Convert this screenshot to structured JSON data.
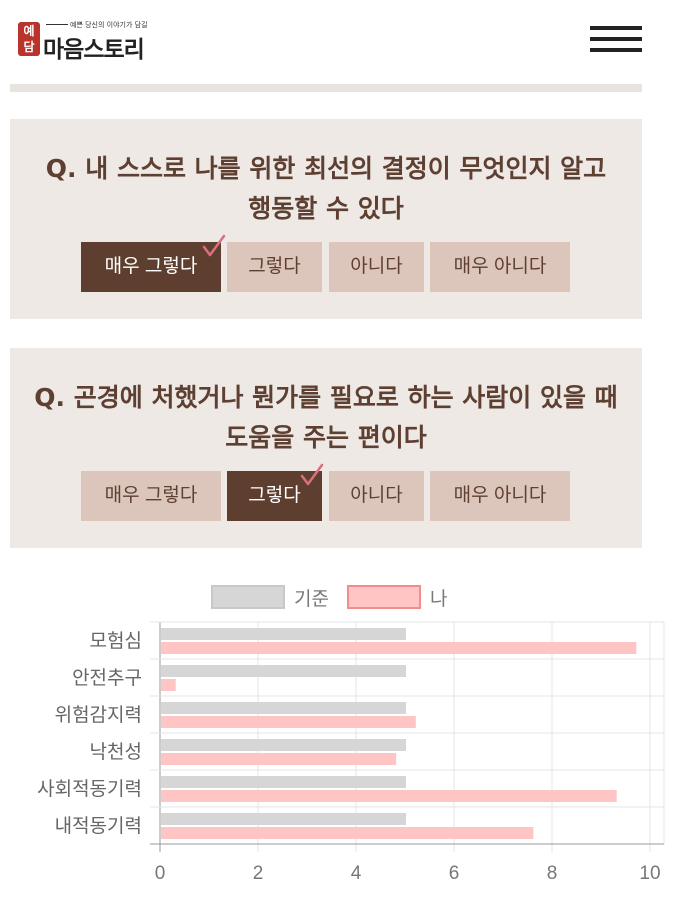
{
  "header": {
    "logo_mark_top": "예",
    "logo_mark_bottom": "담",
    "logo_tagline": "예쁜 당신의 이야기가 담길",
    "logo_text": "마음스토리",
    "menu_icon": "hamburger-icon"
  },
  "questions": [
    {
      "title": "Q. 내 스스로 나를 위한 최선의 결정이 무엇인지 알고 행동할 수 있다",
      "selected": 0,
      "options": [
        "매우 그렇다",
        "그렇다",
        "아니다",
        "매우 아니다"
      ]
    },
    {
      "title": "Q. 곤경에 처했거나 뭔가를 필요로 하는 사람이 있을 때 도움을 주는 편이다",
      "selected": 1,
      "options": [
        "매우 그렇다",
        "그렇다",
        "아니다",
        "매우 아니다"
      ]
    }
  ],
  "colors": {
    "accent": "#5e3f2f",
    "option_bg": "#dcc6bb",
    "card_bg": "#efe9e6",
    "check": "#d9707c",
    "series_base": "#d6d6d6",
    "series_me": "#ffc4c4",
    "series_me_border": "#f08e8e"
  },
  "chart_data": {
    "type": "bar",
    "orientation": "horizontal",
    "categories": [
      "모험심",
      "안전추구",
      "위험감지력",
      "낙천성",
      "사회적동기력",
      "내적동기력"
    ],
    "series": [
      {
        "name": "기준",
        "values": [
          5,
          5,
          5,
          5,
          5,
          5
        ]
      },
      {
        "name": "나",
        "values": [
          9.7,
          0.3,
          5.2,
          4.8,
          9.3,
          7.6
        ]
      }
    ],
    "xlim": [
      0,
      10
    ],
    "xticks": [
      "0",
      "2",
      "4",
      "6",
      "8",
      "10"
    ],
    "grid": true,
    "legend": "top"
  }
}
